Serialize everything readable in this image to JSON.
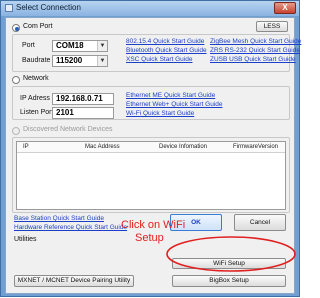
{
  "window": {
    "title": "Select Connection",
    "close_glyph": "X"
  },
  "com_port": {
    "radio_label": "Com Port",
    "port_label": "Port",
    "port_value": "COM18",
    "baud_label": "Baudrate",
    "baud_value": "115200",
    "less_button": "LESS",
    "links_col1": [
      "802.15.4 Quick Start Guide",
      "Bluetooth Quick Start Guide",
      "XSC Quick Start Guide"
    ],
    "links_col2": [
      "ZigBee Mesh Quick Start Guide",
      "ZRS RS-232 Quick Start Guide",
      "ZUSB USB Quick Start Guide"
    ]
  },
  "network": {
    "radio_label": "Network",
    "ip_label": "IP Adress",
    "ip_value": "192.168.0.71",
    "listen_label": "Listen Port",
    "listen_value": "2101",
    "links": [
      "Ethernet ME Quick Start Guide",
      "Ethernet Web+ Quick Start Guide",
      "Wi-Fi Quick Start Guide"
    ]
  },
  "discovered": {
    "radio_label": "Discovered Network Devices",
    "columns": [
      "IP",
      "Mac Address",
      "Device Infomation",
      "FirmwareVersion"
    ]
  },
  "footer": {
    "links": [
      "Base Station Quick Start Guide",
      "Hardware Reference Quick Start Guide"
    ],
    "ok_button": "OK",
    "cancel_button": "Cancel",
    "utilities_label": "Utilities",
    "wifi_setup_button": "WiFi Setup",
    "pairing_button": "MXNET / MCNET Device Pairing Utility",
    "bigbox_button": "BigBox Setup"
  },
  "annotation": {
    "line1": "Click on WiFi",
    "line2": "Setup",
    "color": "#e02020"
  }
}
